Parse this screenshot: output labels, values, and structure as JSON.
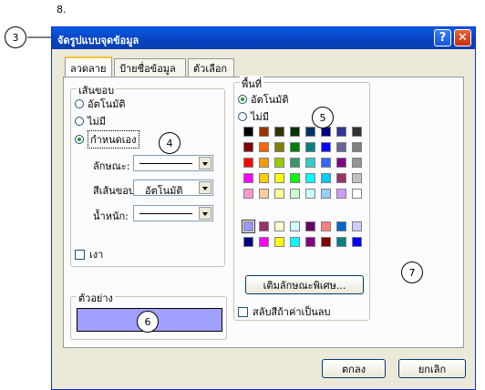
{
  "page_number": "8.",
  "callouts": {
    "c3": "3",
    "c4": "4",
    "c5": "5",
    "c6": "6",
    "c7": "7"
  },
  "window": {
    "title": "จัดรูปแบบจุดข้อมูล",
    "help_label": "?",
    "close_label": "✕"
  },
  "tabs": [
    "ลวดลาย",
    "ป้ายชื่อข้อมูล",
    "ตัวเลือก"
  ],
  "border_group": {
    "title": "เส้นขอบ",
    "options": [
      "อัตโนมัติ",
      "ไม่มี",
      "กำหนดเอง"
    ],
    "selected": "กำหนดเอง",
    "style_label": "ลักษณะ:",
    "color_label": "สีเส้นขอบ:",
    "color_value": "อัตโนมัติ",
    "weight_label": "น้ำหนัก:",
    "shadow_label": "เงา"
  },
  "sample_group": {
    "title": "ตัวอย่าง",
    "fill_color": "#a0a0ff"
  },
  "area_group": {
    "title": "พื้นที่",
    "options": [
      "อัตโนมัติ",
      "ไม่มี"
    ],
    "selected": "อัตโนมัติ",
    "palette": [
      [
        "#000000",
        "#993300",
        "#333300",
        "#003300",
        "#003366",
        "#000080",
        "#333399",
        "#333333"
      ],
      [
        "#800000",
        "#ff6600",
        "#808000",
        "#008000",
        "#008080",
        "#0000ff",
        "#666699",
        "#808080"
      ],
      [
        "#ff0000",
        "#ff9900",
        "#99cc00",
        "#339966",
        "#33cccc",
        "#3366ff",
        "#800080",
        "#969696"
      ],
      [
        "#ff00ff",
        "#ffcc00",
        "#ffff00",
        "#00ff00",
        "#00ffff",
        "#00ccff",
        "#993366",
        "#c0c0c0"
      ],
      [
        "#ff99cc",
        "#ffcc99",
        "#ffff99",
        "#ccffcc",
        "#ccffff",
        "#99ccff",
        "#cc99ff",
        "#ffffff"
      ]
    ],
    "chart_palette": [
      [
        "#9999ff",
        "#993366",
        "#ffffcc",
        "#ccffff",
        "#660066",
        "#ff8080",
        "#0066cc",
        "#ccccff"
      ],
      [
        "#000080",
        "#ff00ff",
        "#ffff00",
        "#00ffff",
        "#800080",
        "#800000",
        "#008080",
        "#0000ff"
      ]
    ],
    "fill_effects_label": "เติมลักษณะพิเศษ...",
    "invert_label": "สลับสีถ้าค่าเป็นลบ"
  },
  "buttons": {
    "ok": "ตกลง",
    "cancel": "ยกเลิก"
  }
}
